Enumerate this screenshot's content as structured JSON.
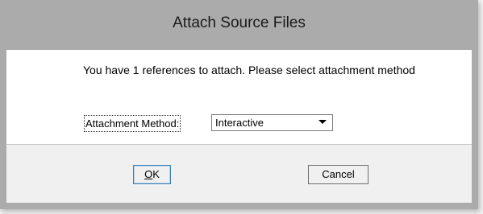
{
  "dialog": {
    "title": "Attach Source Files",
    "message": "You have 1 references to attach. Please select attachment method",
    "method_label": "Attachment Method:",
    "method_selected": "Interactive",
    "ok_accel": "O",
    "ok_rest": "K",
    "cancel_label": "Cancel"
  },
  "icons": {
    "dropdown": "chevron-down-icon"
  }
}
